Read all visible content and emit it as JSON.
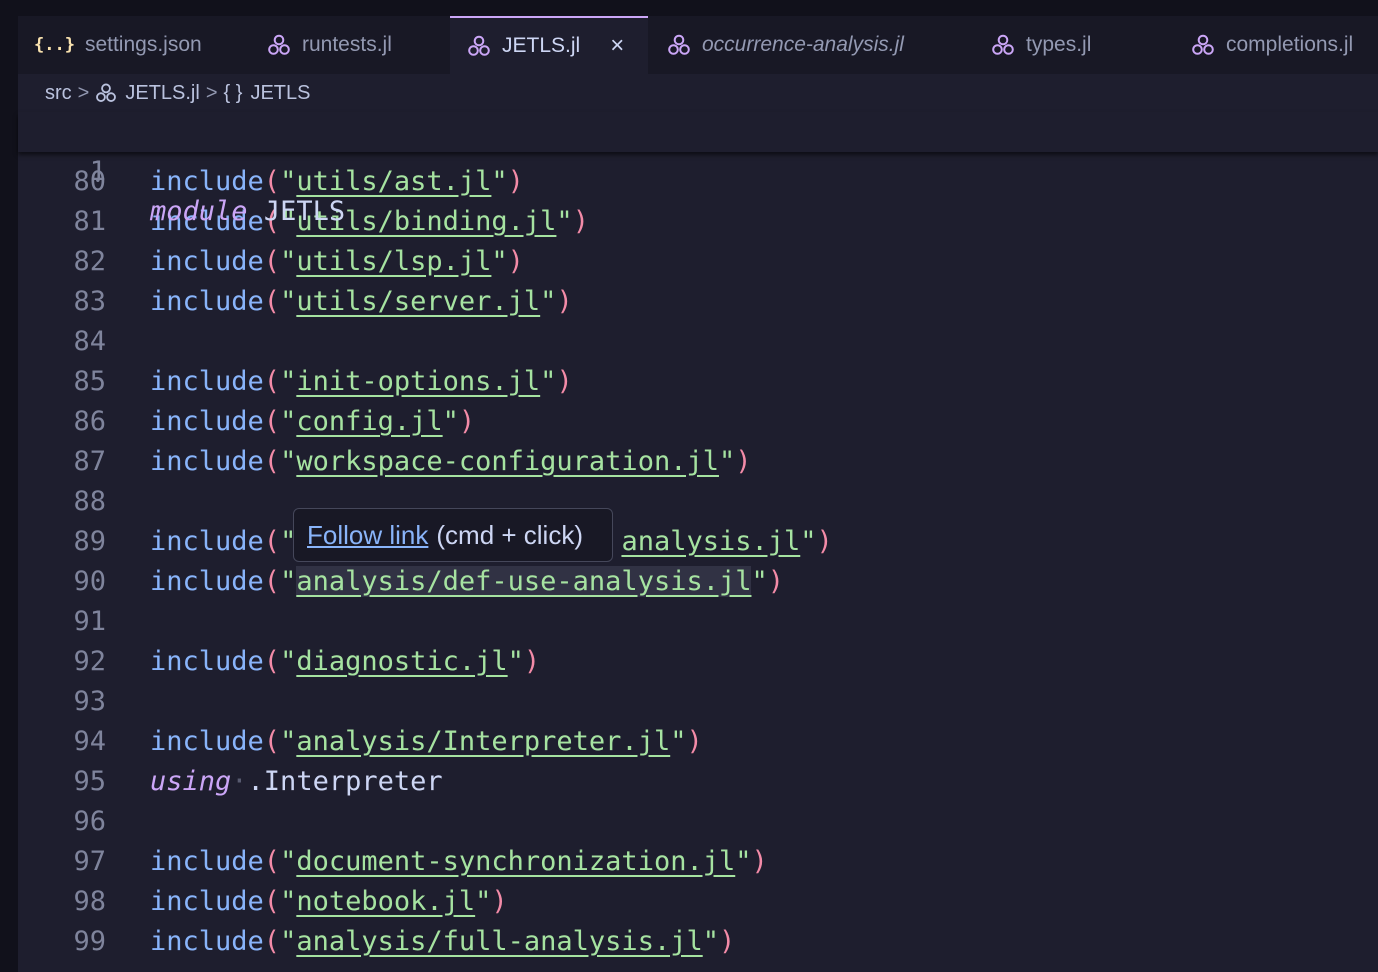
{
  "tabs": [
    {
      "label": "settings.json",
      "icon": "json-braces-icon",
      "active": false,
      "italic": false
    },
    {
      "label": "runtests.jl",
      "icon": "julia-icon",
      "active": false,
      "italic": false
    },
    {
      "label": "JETLS.jl",
      "icon": "julia-icon",
      "active": true,
      "italic": false
    },
    {
      "label": "occurrence-analysis.jl",
      "icon": "julia-icon",
      "active": false,
      "italic": true
    },
    {
      "label": "types.jl",
      "icon": "julia-icon",
      "active": false,
      "italic": false
    },
    {
      "label": "completions.jl",
      "icon": "julia-icon",
      "active": false,
      "italic": false
    }
  ],
  "tab_close_glyph": "×",
  "breadcrumb": {
    "folder": "src",
    "sep": ">",
    "file": "JETLS.jl",
    "symbol_glyph": "{ }",
    "symbol": "JETLS"
  },
  "sticky": {
    "line_no": "1",
    "keyword": "module",
    "name": "JETLS"
  },
  "code": {
    "fn": "include",
    "open_paren": "(",
    "close_paren": ")",
    "quote": "\"",
    "lines": [
      {
        "n": "80",
        "path": "utils/ast.jl"
      },
      {
        "n": "81",
        "path": "utils/binding.jl"
      },
      {
        "n": "82",
        "path": "utils/lsp.jl"
      },
      {
        "n": "83",
        "path": "utils/server.jl"
      },
      {
        "n": "84"
      },
      {
        "n": "85",
        "path": "init-options.jl"
      },
      {
        "n": "86",
        "path": "config.jl"
      },
      {
        "n": "87",
        "path": "workspace-configuration.jl"
      },
      {
        "n": "88"
      },
      {
        "n": "89",
        "path": "analysis/occurrence-analysis.jl",
        "visible_tail": "analysis.jl"
      },
      {
        "n": "90",
        "path": "analysis/def-use-analysis.jl",
        "hover": true
      },
      {
        "n": "91"
      },
      {
        "n": "92",
        "path": "diagnostic.jl"
      },
      {
        "n": "93"
      },
      {
        "n": "94",
        "path": "analysis/Interpreter.jl"
      },
      {
        "n": "95",
        "using": true,
        "keyword": "using",
        "ws_dot": "·",
        "module": ".Interpreter"
      },
      {
        "n": "96"
      },
      {
        "n": "97",
        "path": "document-synchronization.jl"
      },
      {
        "n": "98",
        "path": "notebook.jl"
      },
      {
        "n": "99",
        "path": "analysis/full-analysis.jl"
      }
    ]
  },
  "tooltip": {
    "link": "Follow link",
    "hint": "(cmd + click)"
  },
  "colors": {
    "background": "#1e1e2e",
    "keyword": "#cba6f7",
    "function": "#89b4fa",
    "string": "#a6e3a1",
    "paren": "#f38ba8",
    "line_number": "#7f849c"
  }
}
